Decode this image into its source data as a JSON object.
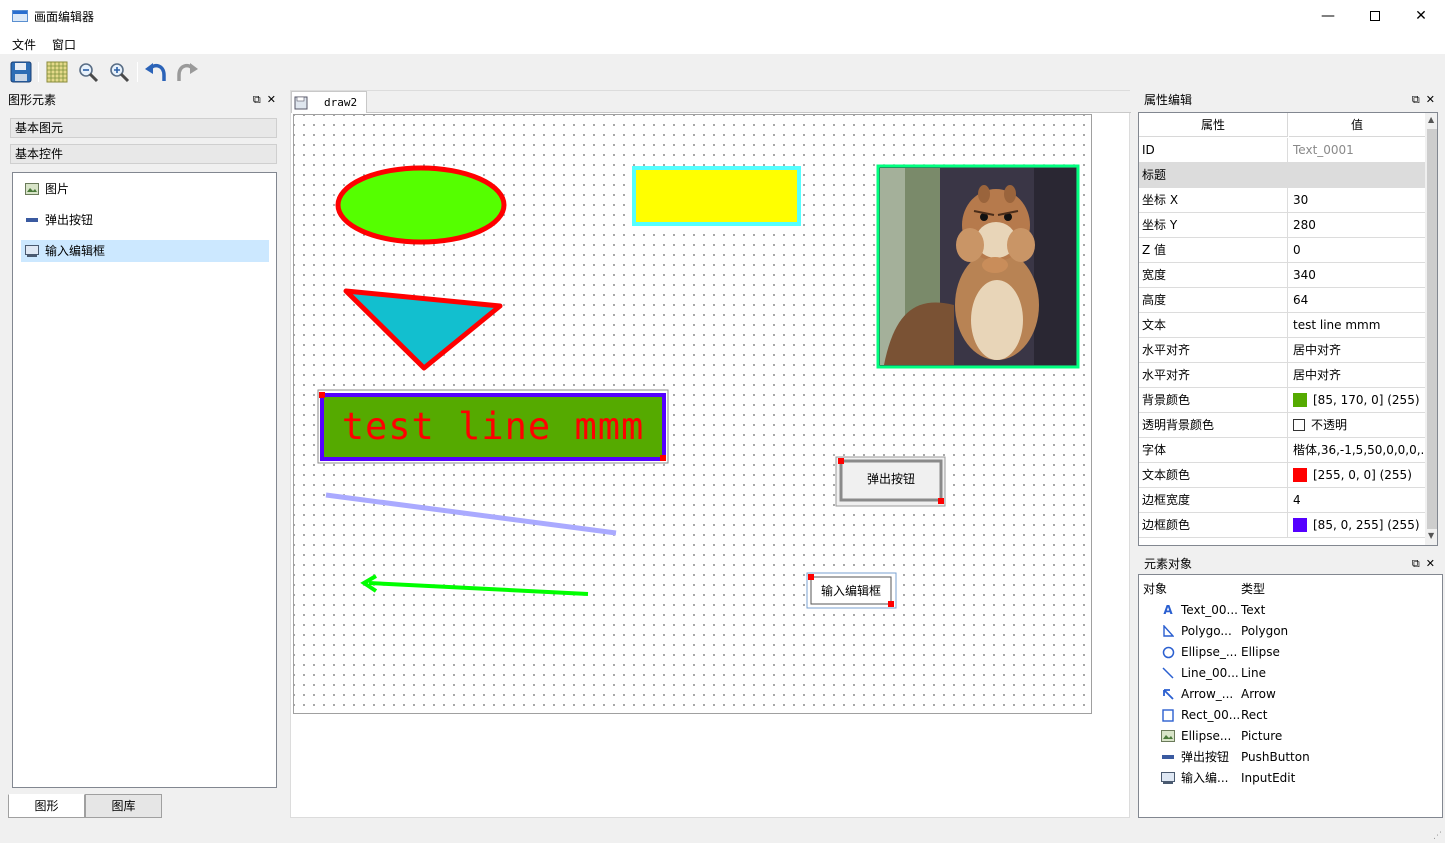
{
  "window": {
    "title": "画面编辑器",
    "min_glyph": "—",
    "close_glyph": "✕"
  },
  "menu": [
    "文件",
    "窗口"
  ],
  "toolbar": {
    "icons": [
      "save-icon",
      "grid-icon",
      "zoom-out-icon",
      "zoom-in-icon",
      "undo-icon",
      "redo-icon"
    ]
  },
  "left_dock": {
    "title": "图形元素",
    "categories": [
      "基本图元",
      "基本控件"
    ],
    "items": [
      {
        "label": "图片",
        "icon": "picture-icon",
        "selected": false
      },
      {
        "label": "弹出按钮",
        "icon": "push-button-icon",
        "selected": false
      },
      {
        "label": "输入编辑框",
        "icon": "input-edit-icon",
        "selected": true
      }
    ],
    "bottom_tabs": [
      "图形",
      "图库"
    ]
  },
  "document": {
    "tab_label": "draw2",
    "shapes": {
      "text_box": {
        "text": "test line mmm",
        "bg": "#55aa00",
        "border": "#5500ff",
        "color": "#ff0000"
      },
      "ellipse": {
        "fill": "#55ff00",
        "stroke": "#ff0000"
      },
      "rect": {
        "fill": "#ffff00",
        "stroke": "#55ffff"
      },
      "triangle": {
        "fill": "#12bfcf",
        "stroke": "#ff0000"
      },
      "line": {
        "stroke": "#aaaaff"
      },
      "arrow": {
        "stroke": "#00ff00"
      },
      "picture_frame": {
        "stroke": "#00ff7f"
      },
      "push_button": {
        "label": "弹出按钮"
      },
      "input_edit": {
        "label": "输入编辑框"
      }
    }
  },
  "props": {
    "title": "属性编辑",
    "col_prop": "属性",
    "col_val": "值",
    "rows": [
      {
        "key": "ID",
        "value": "Text_0001",
        "muted": true
      },
      {
        "key": "标题",
        "value": "",
        "group": true
      },
      {
        "key": "坐标 X",
        "value": "30"
      },
      {
        "key": "坐标 Y",
        "value": "280"
      },
      {
        "key": "Z 值",
        "value": "0"
      },
      {
        "key": "宽度",
        "value": "340"
      },
      {
        "key": "高度",
        "value": "64"
      },
      {
        "key": "文本",
        "value": "test line mmm"
      },
      {
        "key": "水平对齐",
        "value": "居中对齐"
      },
      {
        "key": "水平对齐",
        "value": "居中对齐"
      },
      {
        "key": "背景颜色",
        "value": "[85, 170, 0] (255)",
        "swatch": "#55aa00"
      },
      {
        "key": "透明背景颜色",
        "value": "不透明",
        "checkbox": true
      },
      {
        "key": "字体",
        "value": "楷体,36,-1,5,50,0,0,0,..."
      },
      {
        "key": "文本颜色",
        "value": "[255, 0, 0] (255)",
        "swatch": "#ff0000"
      },
      {
        "key": "边框宽度",
        "value": "4"
      },
      {
        "key": "边框颜色",
        "value": "[85, 0, 255] (255)",
        "swatch": "#5500ff"
      }
    ]
  },
  "objects": {
    "title": "元素对象",
    "col_obj": "对象",
    "col_type": "类型",
    "rows": [
      {
        "name": "Text_00...",
        "type": "Text",
        "icon": "text-icon"
      },
      {
        "name": "Polygo...",
        "type": "Polygon",
        "icon": "polygon-icon"
      },
      {
        "name": "Ellipse_...",
        "type": "Ellipse",
        "icon": "ellipse-icon"
      },
      {
        "name": "Line_00...",
        "type": "Line",
        "icon": "line-icon"
      },
      {
        "name": "Arrow_...",
        "type": "Arrow",
        "icon": "arrow-icon"
      },
      {
        "name": "Rect_00...",
        "type": "Rect",
        "icon": "rect-icon"
      },
      {
        "name": "Ellipse...",
        "type": "Picture",
        "icon": "picture-icon"
      },
      {
        "name": "弹出按钮",
        "type": "PushButton",
        "icon": "push-button-icon"
      },
      {
        "name": "输入编...",
        "type": "InputEdit",
        "icon": "input-edit-icon"
      }
    ]
  }
}
